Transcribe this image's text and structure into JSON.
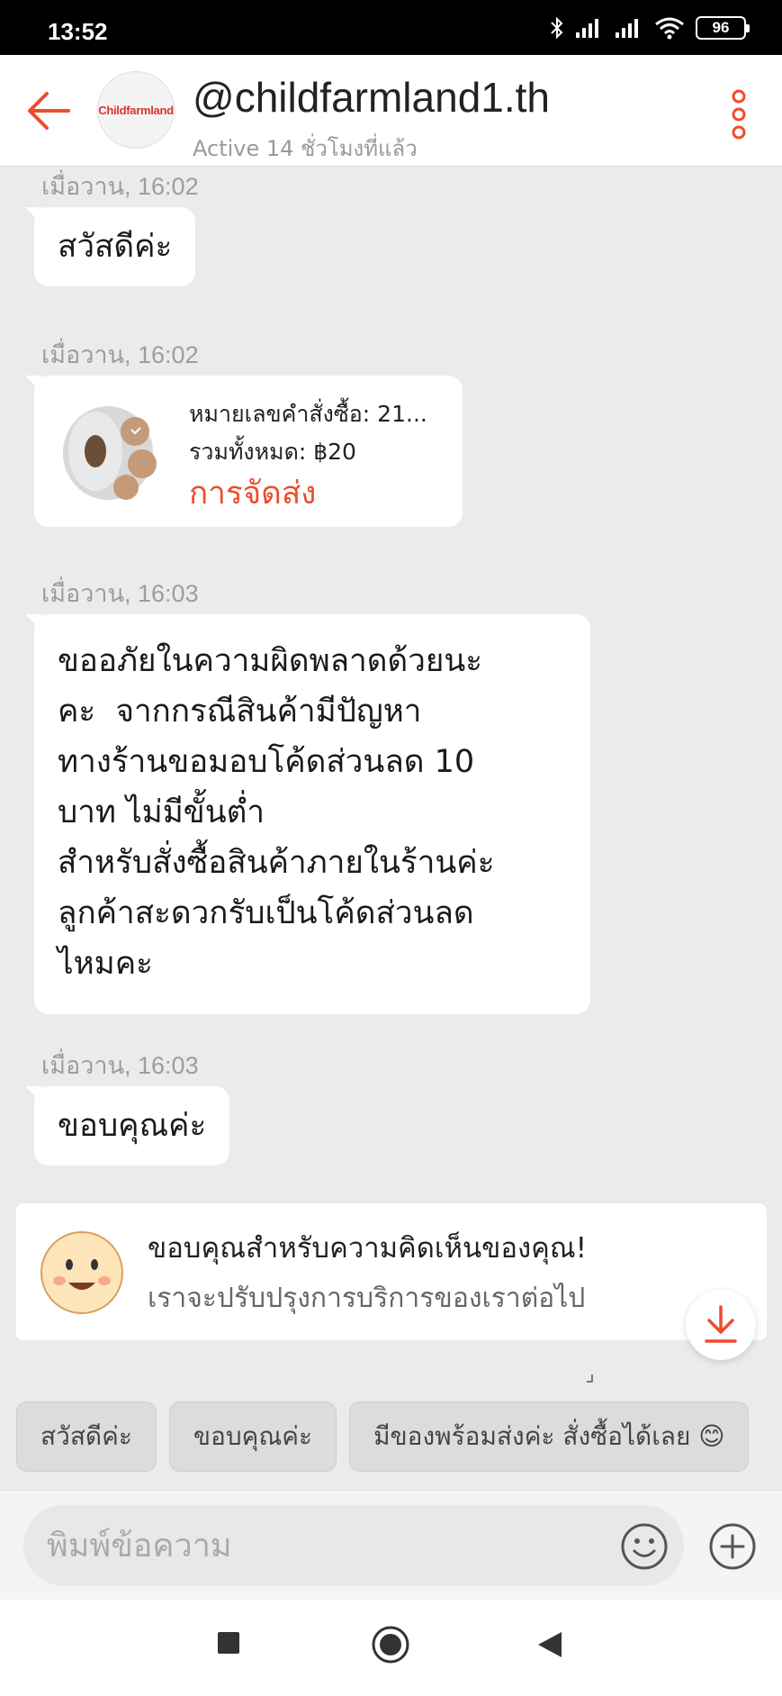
{
  "status_bar": {
    "time": "13:52",
    "battery": "96"
  },
  "header": {
    "avatar_text": "Childfarmland",
    "shop_name": "@childfarmland1.th",
    "status": "Active 14 ชั่วโมงที่แล้ว"
  },
  "messages": [
    {
      "timestamp": "เมื่อวาน, 16:02",
      "text": "สวัสดีค่ะ"
    },
    {
      "timestamp": "เมื่อวาน, 16:02",
      "order": {
        "number_label": "หมายเลขคำสั่งซื้อ: 21...",
        "total_label": "รวมทั้งหมด: ฿20",
        "status": "การจัดส่ง"
      }
    },
    {
      "timestamp": "เมื่อวาน, 16:03",
      "text": "ขออภัยในความผิดพลาดด้วยนะ\nคะ  จากกรณีสินค้ามีปัญหา\nทางร้านขอมอบโค้ดส่วนลด 10\nบาท ไม่มีขั้นต่ำ\nสำหรับสั่งซื้อสินค้าภายในร้านค่ะ\nลูกค้าสะดวกรับเป็นโค้ดส่วนลด\nไหมคะ"
    },
    {
      "timestamp": "เมื่อวาน, 16:03",
      "text": "ขอบคุณค่ะ"
    }
  ],
  "feedback": {
    "title": "ขอบคุณสำหรับความคิดเห็นของคุณ!",
    "subtitle": "เราจะปรับปรุงการบริการของเราต่อไป"
  },
  "quick_replies": [
    "สวัสดีค่ะ",
    "ขอบคุณค่ะ",
    "มีของพร้อมส่งค่ะ สั่งซื้อได้เลย 😊"
  ],
  "input": {
    "placeholder": "พิมพ์ข้อความ"
  },
  "colors": {
    "accent": "#ee4d2d",
    "background": "#ebebeb"
  }
}
